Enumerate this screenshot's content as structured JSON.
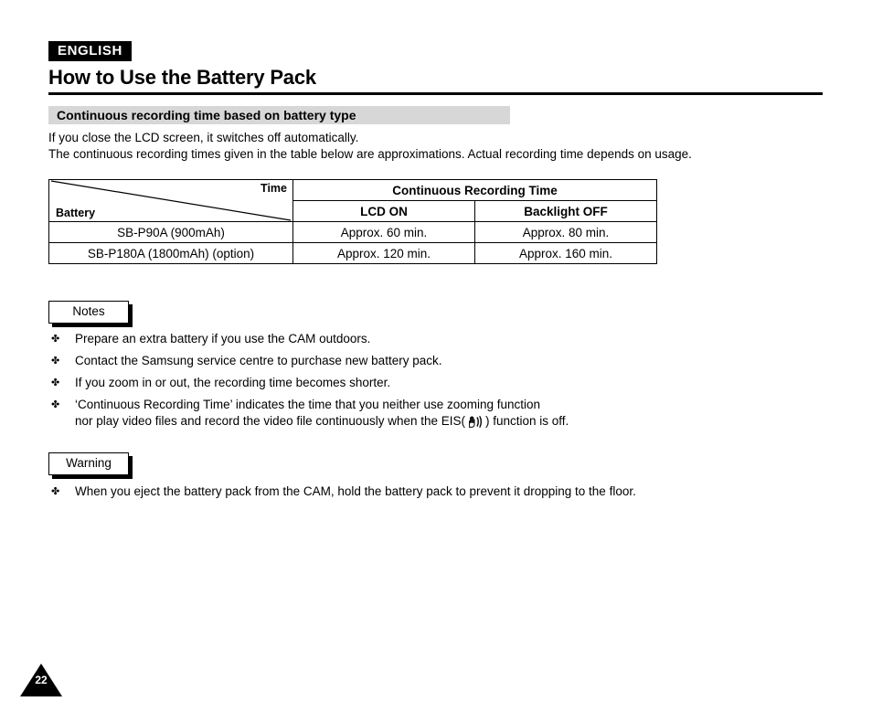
{
  "header": {
    "language_badge": "ENGLISH",
    "title": "How to Use the Battery Pack"
  },
  "section": {
    "heading": "Continuous recording time based on battery type",
    "heading_bg_color": "#d7d7d7"
  },
  "intro": {
    "line1": "If you close the LCD screen, it switches off automatically.",
    "line2": "The continuous recording times given in the table below are approximations. Actual recording time depends on usage."
  },
  "table": {
    "corner_top_label": "Time",
    "corner_bottom_label": "Battery",
    "group_header": "Continuous Recording Time",
    "subheaders": [
      "LCD ON",
      "Backlight OFF"
    ],
    "rows": [
      {
        "battery": "SB-P90A (900mAh)",
        "lcd_on": "Approx. 60 min.",
        "backlight_off": "Approx. 80 min."
      },
      {
        "battery": "SB-P180A (1800mAh) (option)",
        "lcd_on": "Approx. 120 min.",
        "backlight_off": "Approx. 160 min."
      }
    ]
  },
  "notes": {
    "label": "Notes",
    "bullet_mark": "✤",
    "items": [
      {
        "text": "Prepare an extra battery if you use the CAM outdoors."
      },
      {
        "text": "Contact the Samsung service centre to purchase new battery pack."
      },
      {
        "text": "If you zoom in or out, the recording time becomes shorter."
      },
      {
        "text": "‘Continuous Recording Time’ indicates the time that you neither use zooming function",
        "line2_before_icon": "nor play video files and record the video file continuously when the EIS(",
        "icon_name": "eis-hand-icon",
        "line2_after_icon": ") function is off."
      }
    ]
  },
  "warning": {
    "label": "Warning",
    "bullet_mark": "✤",
    "items": [
      {
        "text": "When you eject the battery pack from the CAM, hold the battery pack to prevent it dropping to the floor."
      }
    ]
  },
  "footer": {
    "page_number": "22"
  }
}
